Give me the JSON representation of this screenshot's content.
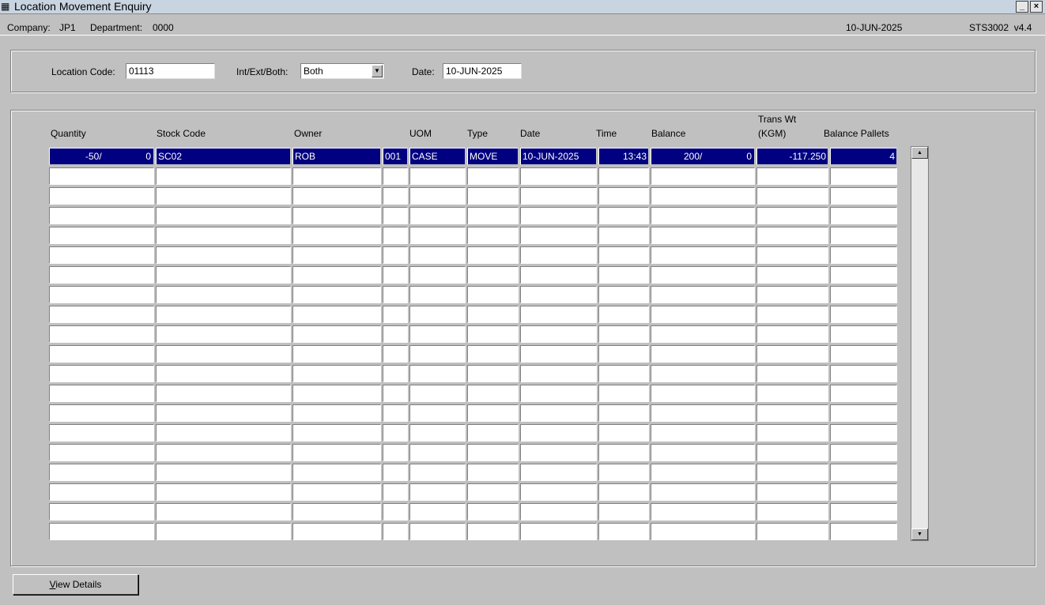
{
  "window": {
    "title": "Location Movement Enquiry",
    "minimize_glyph": "_",
    "close_glyph": "×"
  },
  "info": {
    "company_label": "Company:",
    "company_value": "JP1",
    "department_label": "Department:",
    "department_value": "0000",
    "date": "10-JUN-2025",
    "program": "STS3002  v4.4"
  },
  "criteria": {
    "location_code_label": "Location Code:",
    "location_code_value": "01113",
    "int_ext_label": "Int/Ext/Both:",
    "int_ext_value": "Both",
    "date_label": "Date:",
    "date_value": "10-JUN-2025"
  },
  "table": {
    "headers": {
      "quantity": "Quantity",
      "stock_code": "Stock Code",
      "owner": "Owner",
      "uom": "UOM",
      "type": "Type",
      "date": "Date",
      "time": "Time",
      "balance": "Balance",
      "trans_wt_1": "Trans Wt",
      "trans_wt_2": "(KGM)",
      "balance_pallets": "Balance Pallets"
    },
    "rows": [
      {
        "qty_a": "-50/",
        "qty_b": "0",
        "stock_code": "SC02",
        "owner": "ROB",
        "owner_code": "001",
        "uom": "CASE",
        "type": "MOVE",
        "date": "10-JUN-2025",
        "time": "13:43",
        "bal_a": "200/",
        "bal_b": "0",
        "trans_wt": "-117.250",
        "balance_pallets": "4"
      }
    ]
  },
  "buttons": {
    "view_details_first": "V",
    "view_details_rest": "iew Details"
  }
}
